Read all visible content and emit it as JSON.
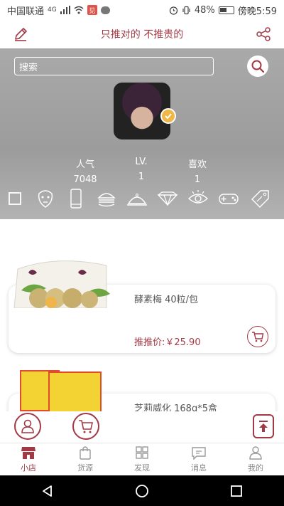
{
  "status_bar": {
    "carrier": "中国联通",
    "network": "4G",
    "app_badge": "见",
    "battery": "48%",
    "time": "傍晚5:59"
  },
  "header": {
    "title": "只推对的 不推贵的"
  },
  "profile": {
    "search_placeholder": "搜索",
    "stats": [
      {
        "label": "人气",
        "value": "7048"
      },
      {
        "label": "LV.",
        "value": "1"
      },
      {
        "label": "喜欢",
        "value": "1"
      }
    ],
    "categories": [
      "square",
      "face-mask",
      "phone",
      "burger",
      "dish-cover",
      "diamond",
      "eye",
      "gamepad",
      "sale-tag"
    ]
  },
  "products": [
    {
      "title": "酵素梅 40粒/包",
      "price": "推推价:￥25.90"
    },
    {
      "title": "芝莉威化 168g*5盒"
    }
  ],
  "bottom_nav": [
    {
      "label": "小店",
      "icon": "shop-icon",
      "active": true
    },
    {
      "label": "货源",
      "icon": "bag-icon",
      "active": false
    },
    {
      "label": "发现",
      "icon": "grid-icon",
      "active": false
    },
    {
      "label": "消息",
      "icon": "message-icon",
      "active": false
    },
    {
      "label": "我的",
      "icon": "person-icon",
      "active": false
    }
  ],
  "colors": {
    "accent": "#a23a45",
    "profile_bg": "#a9a9a9",
    "verified": "#f0b646"
  }
}
